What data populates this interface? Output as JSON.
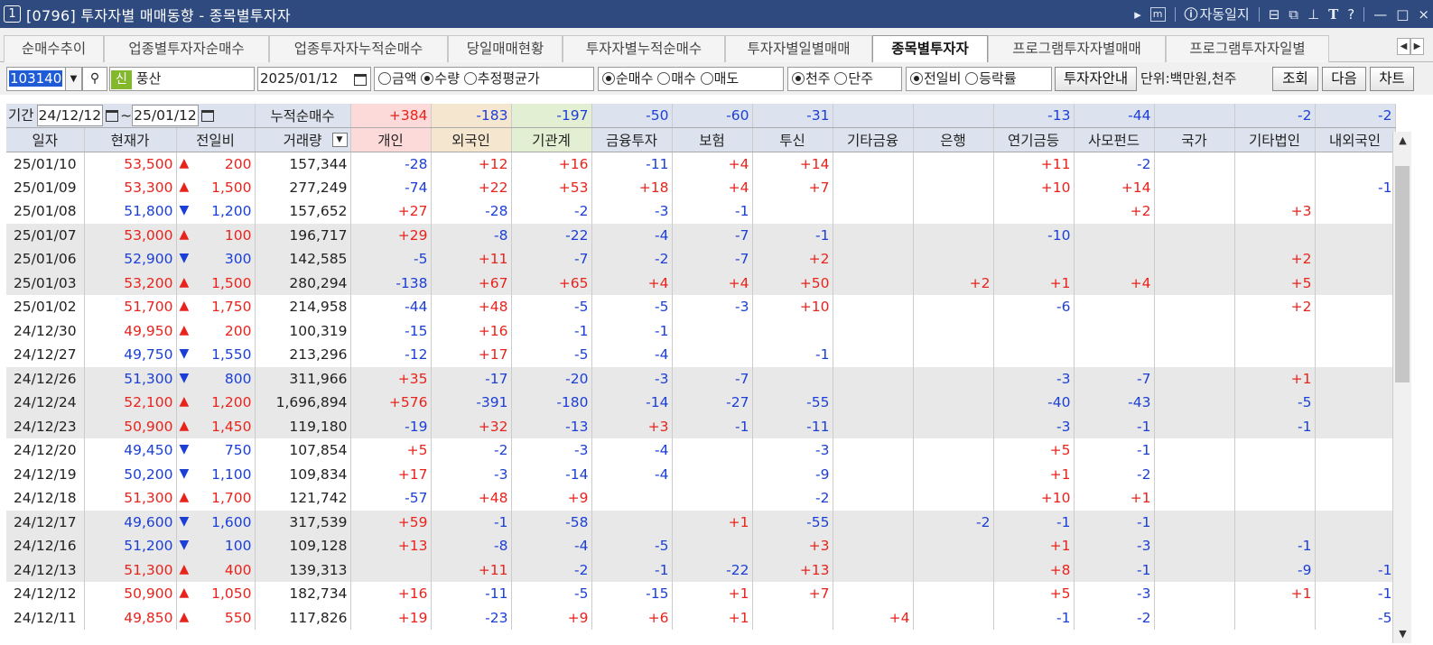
{
  "window": {
    "number": "1",
    "title": "[0796] 투자자별 매매동향 - 종목별투자자",
    "auto_log": "자동일지",
    "controls": [
      "▸",
      "m",
      "ⓘ",
      "□",
      "▢",
      "📌",
      "T",
      "?",
      "—",
      "□",
      "×"
    ]
  },
  "tabs": [
    {
      "label": "순매수추이"
    },
    {
      "label": "업종별투자자순매수"
    },
    {
      "label": "업종투자자누적순매수"
    },
    {
      "label": "당일매매현황"
    },
    {
      "label": "투자자별누적순매수"
    },
    {
      "label": "투자자별일별매매"
    },
    {
      "label": "종목별투자자"
    },
    {
      "label": "프로그램투자자별매매"
    },
    {
      "label": "프로그램투자자일별"
    }
  ],
  "active_tab": "종목별투자자",
  "toolbar": {
    "code": "103140",
    "credit_badge": "신",
    "stock_name": "풍산",
    "date": "2025/01/12",
    "radio_amount": "금액",
    "radio_qty": "수량",
    "radio_avg": "추정평균가",
    "radio_net": "순매수",
    "radio_buy": "매수",
    "radio_sell": "매도",
    "radio_k": "천주",
    "radio_one": "단주",
    "radio_prev": "전일비",
    "radio_rate": "등락률",
    "guide_button": "투자자안내",
    "unit": "단위:백만원,천주",
    "search_button": "조회",
    "next_button": "다음",
    "chart_button": "차트"
  },
  "period": {
    "label": "기간",
    "from": "24/12/12",
    "tilde": "~",
    "to": "25/01/12",
    "cum_label": "누적순매수"
  },
  "summary": [
    "+384",
    "-183",
    "-197",
    "-50",
    "-60",
    "-31",
    "",
    "",
    "-13",
    "-44",
    "",
    "-2",
    "-2"
  ],
  "headers": [
    "일자",
    "현재가",
    "전일비",
    "거래량",
    "개인",
    "외국인",
    "기관계",
    "금융투자",
    "보험",
    "투신",
    "기타금융",
    "은행",
    "연기금등",
    "사모펀드",
    "국가",
    "기타법인",
    "내외국인"
  ],
  "rows": [
    {
      "date": "25/01/10",
      "price": "53,500",
      "dir": "▲",
      "chg": "200",
      "vol": "157,344",
      "vals": [
        "-28",
        "+12",
        "+16",
        "-11",
        "+4",
        "+14",
        "",
        "",
        "+11",
        "-2",
        "",
        "",
        ""
      ]
    },
    {
      "date": "25/01/09",
      "price": "53,300",
      "dir": "▲",
      "chg": "1,500",
      "vol": "277,249",
      "vals": [
        "-74",
        "+22",
        "+53",
        "+18",
        "+4",
        "+7",
        "",
        "",
        "+10",
        "+14",
        "",
        "",
        "-1"
      ]
    },
    {
      "date": "25/01/08",
      "price": "51,800",
      "dir": "▼",
      "chg": "1,200",
      "vol": "157,652",
      "vals": [
        "+27",
        "-28",
        "-2",
        "-3",
        "-1",
        "",
        "",
        "",
        "",
        "+2",
        "",
        "+3",
        ""
      ]
    },
    {
      "date": "25/01/07",
      "price": "53,000",
      "dir": "▲",
      "chg": "100",
      "vol": "196,717",
      "vals": [
        "+29",
        "-8",
        "-22",
        "-4",
        "-7",
        "-1",
        "",
        "",
        "-10",
        "",
        "",
        "",
        ""
      ]
    },
    {
      "date": "25/01/06",
      "price": "52,900",
      "dir": "▼",
      "chg": "300",
      "vol": "142,585",
      "vals": [
        "-5",
        "+11",
        "-7",
        "-2",
        "-7",
        "+2",
        "",
        "",
        "",
        "",
        "",
        "+2",
        ""
      ]
    },
    {
      "date": "25/01/03",
      "price": "53,200",
      "dir": "▲",
      "chg": "1,500",
      "vol": "280,294",
      "vals": [
        "-138",
        "+67",
        "+65",
        "+4",
        "+4",
        "+50",
        "",
        "+2",
        "+1",
        "+4",
        "",
        "+5",
        ""
      ]
    },
    {
      "date": "25/01/02",
      "price": "51,700",
      "dir": "▲",
      "chg": "1,750",
      "vol": "214,958",
      "vals": [
        "-44",
        "+48",
        "-5",
        "-5",
        "-3",
        "+10",
        "",
        "",
        "-6",
        "",
        "",
        "+2",
        ""
      ]
    },
    {
      "date": "24/12/30",
      "price": "49,950",
      "dir": "▲",
      "chg": "200",
      "vol": "100,319",
      "vals": [
        "-15",
        "+16",
        "-1",
        "-1",
        "",
        "",
        "",
        "",
        "",
        "",
        "",
        "",
        ""
      ]
    },
    {
      "date": "24/12/27",
      "price": "49,750",
      "dir": "▼",
      "chg": "1,550",
      "vol": "213,296",
      "vals": [
        "-12",
        "+17",
        "-5",
        "-4",
        "",
        "-1",
        "",
        "",
        "",
        "",
        "",
        "",
        ""
      ]
    },
    {
      "date": "24/12/26",
      "price": "51,300",
      "dir": "▼",
      "chg": "800",
      "vol": "311,966",
      "vals": [
        "+35",
        "-17",
        "-20",
        "-3",
        "-7",
        "",
        "",
        "",
        "-3",
        "-7",
        "",
        "+1",
        ""
      ]
    },
    {
      "date": "24/12/24",
      "price": "52,100",
      "dir": "▲",
      "chg": "1,200",
      "vol": "1,696,894",
      "vals": [
        "+576",
        "-391",
        "-180",
        "-14",
        "-27",
        "-55",
        "",
        "",
        "-40",
        "-43",
        "",
        "-5",
        ""
      ]
    },
    {
      "date": "24/12/23",
      "price": "50,900",
      "dir": "▲",
      "chg": "1,450",
      "vol": "119,180",
      "vals": [
        "-19",
        "+32",
        "-13",
        "+3",
        "-1",
        "-11",
        "",
        "",
        "-3",
        "-1",
        "",
        "-1",
        ""
      ]
    },
    {
      "date": "24/12/20",
      "price": "49,450",
      "dir": "▼",
      "chg": "750",
      "vol": "107,854",
      "vals": [
        "+5",
        "-2",
        "-3",
        "-4",
        "",
        "-3",
        "",
        "",
        "+5",
        "-1",
        "",
        "",
        ""
      ]
    },
    {
      "date": "24/12/19",
      "price": "50,200",
      "dir": "▼",
      "chg": "1,100",
      "vol": "109,834",
      "vals": [
        "+17",
        "-3",
        "-14",
        "-4",
        "",
        "-9",
        "",
        "",
        "+1",
        "-2",
        "",
        "",
        ""
      ]
    },
    {
      "date": "24/12/18",
      "price": "51,300",
      "dir": "▲",
      "chg": "1,700",
      "vol": "121,742",
      "vals": [
        "-57",
        "+48",
        "+9",
        "",
        "",
        "-2",
        "",
        "",
        "+10",
        "+1",
        "",
        "",
        ""
      ]
    },
    {
      "date": "24/12/17",
      "price": "49,600",
      "dir": "▼",
      "chg": "1,600",
      "vol": "317,539",
      "vals": [
        "+59",
        "-1",
        "-58",
        "",
        "+1",
        "-55",
        "",
        "-2",
        "-1",
        "-1",
        "",
        "",
        ""
      ]
    },
    {
      "date": "24/12/16",
      "price": "51,200",
      "dir": "▼",
      "chg": "100",
      "vol": "109,128",
      "vals": [
        "+13",
        "-8",
        "-4",
        "-5",
        "",
        "+3",
        "",
        "",
        "+1",
        "-3",
        "",
        "-1",
        ""
      ]
    },
    {
      "date": "24/12/13",
      "price": "51,300",
      "dir": "▲",
      "chg": "400",
      "vol": "139,313",
      "vals": [
        "",
        "+11",
        "-2",
        "-1",
        "-22",
        "+13",
        "",
        "",
        "+8",
        "-1",
        "",
        "-9",
        "-1"
      ]
    },
    {
      "date": "24/12/12",
      "price": "50,900",
      "dir": "▲",
      "chg": "1,050",
      "vol": "182,734",
      "vals": [
        "+16",
        "-11",
        "-5",
        "-15",
        "+1",
        "+7",
        "",
        "",
        "+5",
        "-3",
        "",
        "+1",
        "-1"
      ]
    },
    {
      "date": "24/12/11",
      "price": "49,850",
      "dir": "▲",
      "chg": "550",
      "vol": "117,826",
      "vals": [
        "+19",
        "-23",
        "+9",
        "+6",
        "+1",
        "",
        "+4",
        "",
        "-1",
        "-2",
        "",
        "",
        "-5"
      ]
    }
  ],
  "colors": {
    "titlebar": "#2f4a7e",
    "up": "#e8231c",
    "down": "#1b3fd6",
    "header": "#dde3ee",
    "individual": "#fcdada",
    "foreign": "#f5e6cf",
    "institution": "#e3efd2",
    "shade": "#e8e8e8"
  }
}
